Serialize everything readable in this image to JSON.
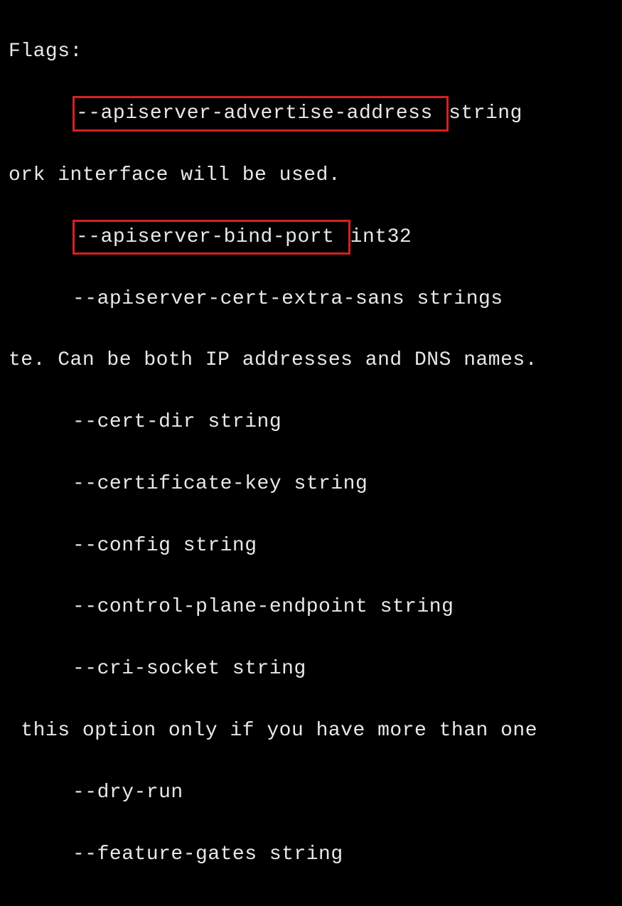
{
  "header": "Flags:",
  "lines": {
    "l1_flag": "--apiserver-advertise-address ",
    "l1_suffix": "string",
    "l2": "ork interface will be used.",
    "l3_flag": "--apiserver-bind-port ",
    "l3_suffix": "int32",
    "l4": "--apiserver-cert-extra-sans strings",
    "l5": "te. Can be both IP addresses and DNS names.",
    "l6": "--cert-dir string",
    "l7": "--certificate-key string",
    "l8": "--config string",
    "l9": "--control-plane-endpoint string",
    "l10": "--cri-socket string",
    "l11": " this option only if you have more than one",
    "l12": "--dry-run",
    "l13": "--feature-gates string"
  }
}
